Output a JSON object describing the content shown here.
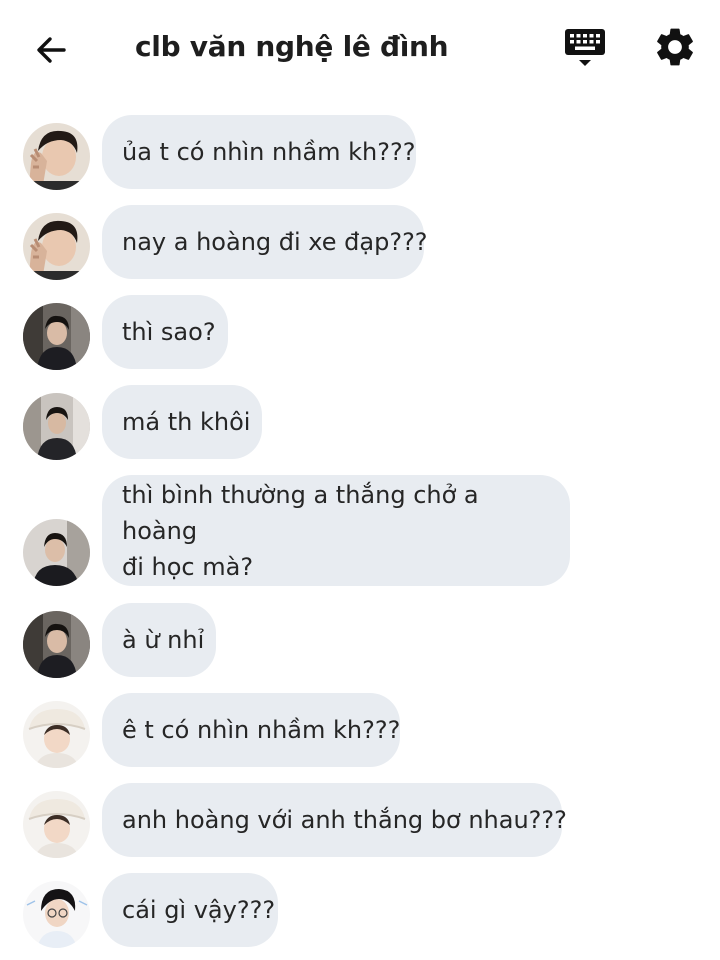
{
  "header": {
    "title": "clb văn nghệ lê đình",
    "back_icon": "arrow-left-icon",
    "keyboard_icon": "keyboard-icon",
    "settings_icon": "gear-icon"
  },
  "messages": [
    {
      "avatar": "avatar-1",
      "text": "ủa t có nhìn nhầm kh???"
    },
    {
      "avatar": "avatar-1",
      "text": "nay a hoàng đi xe đạp???"
    },
    {
      "avatar": "avatar-2",
      "text": "thì sao?"
    },
    {
      "avatar": "avatar-3",
      "text": "má th khôi"
    },
    {
      "avatar": "avatar-4",
      "lines": [
        "thì bình thường a thắng chở a hoàng",
        "đi học mà?"
      ]
    },
    {
      "avatar": "avatar-2",
      "text": "à ừ nhỉ"
    },
    {
      "avatar": "avatar-5",
      "text": "ê t có nhìn nhầm kh???"
    },
    {
      "avatar": "avatar-5",
      "text": "anh hoàng với anh thắng bơ nhau???"
    },
    {
      "avatar": "avatar-6",
      "text": "cái gì vậy???"
    }
  ],
  "colors": {
    "bubble": "#e8ecf1",
    "text": "#262626",
    "icon": "#111111"
  }
}
